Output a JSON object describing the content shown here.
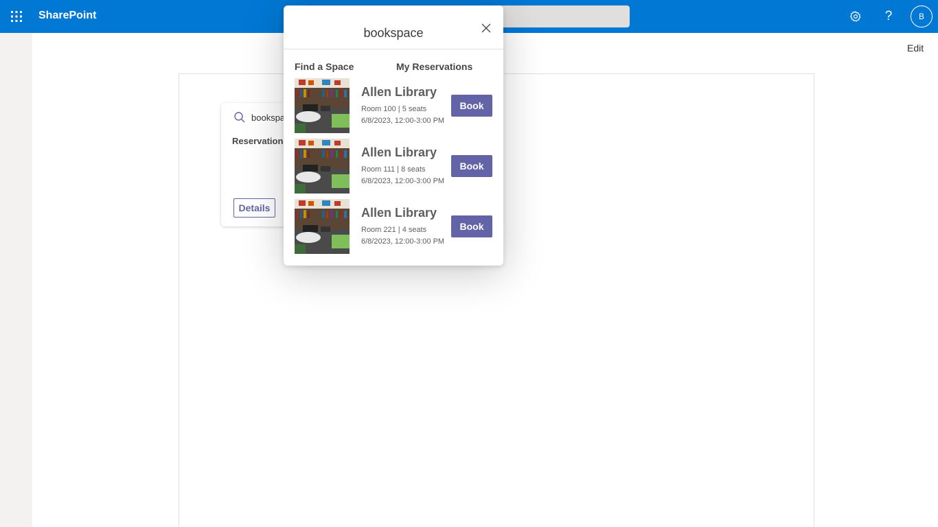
{
  "suitebar": {
    "app_name": "SharePoint",
    "avatar_initial": "B",
    "help_glyph": "?",
    "color": "#0078d4"
  },
  "page": {
    "edit_label": "Edit"
  },
  "card": {
    "search_text": "bookspa",
    "label": "Reservation",
    "details_button": "Details"
  },
  "popup": {
    "title": "bookspace",
    "tabs": [
      {
        "label": "Find a Space"
      },
      {
        "label": "My Reservations"
      }
    ],
    "rooms": [
      {
        "name": "Allen Library",
        "info": "Room 100 | 5 seats",
        "time": "6/8/2023, 12:00-3:00 PM",
        "button": "Book"
      },
      {
        "name": "Allen Library",
        "info": "Room 111 | 8 seats",
        "time": "6/8/2023, 12:00-3:00 PM",
        "button": "Book"
      },
      {
        "name": "Allen Library",
        "info": "Room 221 | 4 seats",
        "time": "6/8/2023, 12:00-3:00 PM",
        "button": "Book"
      }
    ],
    "accent": "#6264a7"
  }
}
